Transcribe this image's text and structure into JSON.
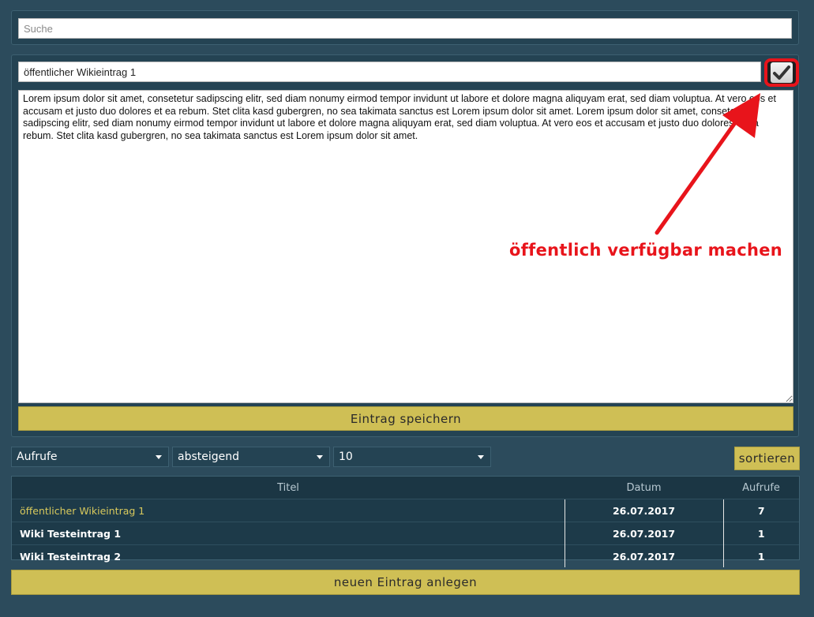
{
  "search": {
    "placeholder": "Suche"
  },
  "editor": {
    "title_value": "öffentlicher Wikieintrag 1",
    "content": "Lorem ipsum dolor sit amet, consetetur sadipscing elitr, sed diam nonumy eirmod tempor invidunt ut labore et dolore magna aliquyam erat, sed diam voluptua. At vero eos et accusam et justo duo dolores et ea rebum. Stet clita kasd gubergren, no sea takimata sanctus est Lorem ipsum dolor sit amet. Lorem ipsum dolor sit amet, consetetur sadipscing elitr, sed diam nonumy eirmod tempor invidunt ut labore et dolore magna aliquyam erat, sed diam voluptua. At vero eos et accusam et justo duo dolores et ea rebum. Stet clita kasd gubergren, no sea takimata sanctus est Lorem ipsum dolor sit amet.",
    "public_checked": true,
    "save_label": "Eintrag speichern"
  },
  "filters": {
    "sort_field": "Aufrufe",
    "sort_order": "absteigend",
    "page_size": "10",
    "sort_button": "sortieren"
  },
  "table": {
    "headers": [
      "Titel",
      "Datum",
      "Aufrufe"
    ],
    "rows": [
      {
        "title": "öffentlicher Wikieintrag 1",
        "date": "26.07.2017",
        "views": "7"
      },
      {
        "title": "Wiki Testeintrag 1",
        "date": "26.07.2017",
        "views": "1"
      },
      {
        "title": "Wiki Testeintrag 2",
        "date": "26.07.2017",
        "views": "1"
      }
    ]
  },
  "new_entry_label": "neuen Eintrag anlegen",
  "annotation": {
    "text": "öffentlich verfügbar machen",
    "color": "#e8141b"
  },
  "colors": {
    "accent": "#cfbf55",
    "background": "#2c4b5c",
    "highlight": "#e8141b"
  }
}
